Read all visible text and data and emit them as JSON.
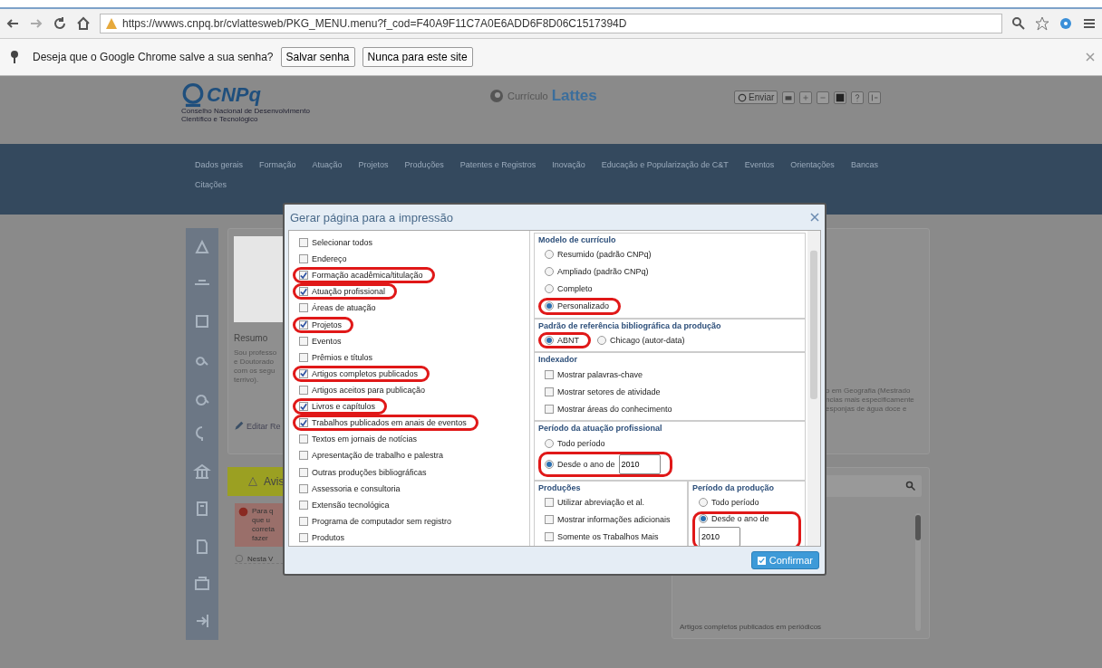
{
  "browser": {
    "url": "https://wwws.cnpq.br/cvlattesweb/PKG_MENU.menu?f_cod=F40A9F11C7A0E6ADD6F8D06C1517394D",
    "infobar": {
      "message": "Deseja que o Google Chrome salve a sua senha?",
      "buttons": [
        "Salvar senha",
        "Nunca para este site"
      ]
    }
  },
  "header": {
    "logo": "CNPq",
    "logo_subtitle_lines": [
      "Conselho Nacional de Desenvolvimento",
      "Científico e Tecnológico"
    ],
    "brand_prefix": "Currículo",
    "brand": "Lattes",
    "send_button": "Enviar"
  },
  "nav": {
    "items": [
      "Dados gerais",
      "Formação",
      "Atuação",
      "Projetos",
      "Produções",
      "Patentes e Registros",
      "Inovação",
      "Educação e Popularização de C&T",
      "Eventos",
      "Orientações",
      "Bancas",
      "Citações"
    ]
  },
  "profile": {
    "summary_title": "Resumo",
    "summary_lines": [
      "Sou professo",
      "e Doutorado",
      "com os segu",
      "terrivo)."
    ],
    "edit_link": "Editar Re",
    "right_lines": [
      "o em Geografia (Mestrado",
      "ncias mais especificamente",
      "esponjas de água doce e"
    ]
  },
  "notices": {
    "title": "Avis",
    "alert_lines": [
      "Para q",
      "que u",
      "correta",
      "fazer"
    ],
    "info": "Nesta V"
  },
  "list_panel": {
    "items": [
      "Artigos completos publicados em periódicos"
    ]
  },
  "dialog": {
    "title": "Gerar página para a impressão",
    "confirm": "Confirmar",
    "items": [
      {
        "label": "Selecionar todos",
        "checked": false,
        "circled": false
      },
      {
        "label": "Endereço",
        "checked": false,
        "circled": false
      },
      {
        "label": "Formação acadêmica/titulação",
        "checked": true,
        "circled": true
      },
      {
        "label": "Atuação profissional",
        "checked": true,
        "circled": true
      },
      {
        "label": "Áreas de atuação",
        "checked": false,
        "circled": false
      },
      {
        "label": "Projetos",
        "checked": true,
        "circled": true
      },
      {
        "label": "Eventos",
        "checked": false,
        "circled": false
      },
      {
        "label": "Prêmios e títulos",
        "checked": false,
        "circled": false
      },
      {
        "label": "Artigos completos publicados",
        "checked": true,
        "circled": true
      },
      {
        "label": "Artigos aceitos para publicação",
        "checked": false,
        "circled": false
      },
      {
        "label": "Livros e capítulos",
        "checked": true,
        "circled": true
      },
      {
        "label": "Trabalhos publicados em anais de eventos",
        "checked": true,
        "circled": true
      },
      {
        "label": "Textos em jornais de notícias",
        "checked": false,
        "circled": false
      },
      {
        "label": "Apresentação de trabalho e palestra",
        "checked": false,
        "circled": false
      },
      {
        "label": "Outras produções bibliográficas",
        "checked": false,
        "circled": false
      },
      {
        "label": "Assessoria e consultoria",
        "checked": false,
        "circled": false
      },
      {
        "label": "Extensão tecnológica",
        "checked": false,
        "circled": false
      },
      {
        "label": "Programa de computador sem registro",
        "checked": false,
        "circled": false
      },
      {
        "label": "Produtos",
        "checked": false,
        "circled": false
      }
    ],
    "fieldsets": [
      {
        "title": "Modelo de currículo",
        "kind": "radio",
        "options": [
          {
            "label": "Resumido (padrão CNPq)",
            "selected": false,
            "circled": false
          },
          {
            "label": "Ampliado (padrão CNPq)",
            "selected": false,
            "circled": false
          },
          {
            "label": "Completo",
            "selected": false,
            "circled": false
          },
          {
            "label": "Personalizado",
            "selected": true,
            "circled": true
          }
        ]
      },
      {
        "title": "Padrão de referência bibliográfica da produção",
        "kind": "radio",
        "inline": true,
        "options": [
          {
            "label": "ABNT",
            "selected": true,
            "circled": true
          },
          {
            "label": "Chicago (autor-data)",
            "selected": false,
            "circled": false
          }
        ]
      },
      {
        "title": "Indexador",
        "kind": "checkbox",
        "options": [
          {
            "label": "Mostrar palavras-chave",
            "checked": false,
            "circled": false
          },
          {
            "label": "Mostrar setores de atividade",
            "checked": false,
            "circled": false
          },
          {
            "label": "Mostrar áreas do conhecimento",
            "checked": false,
            "circled": false
          }
        ]
      },
      {
        "title": "Período da atuação profissional",
        "kind": "radio",
        "options": [
          {
            "label": "Todo período",
            "selected": false,
            "circled": false
          },
          {
            "label": "Desde o ano de",
            "selected": true,
            "circled": true,
            "year": "2010"
          }
        ]
      }
    ],
    "bottom_fieldsets": [
      {
        "title": "Produções",
        "kind": "checkbox",
        "options": [
          {
            "label": "Utilizar abreviação et al.",
            "checked": false,
            "circled": false
          },
          {
            "label": "Mostrar informações adicionais",
            "checked": false,
            "circled": false
          },
          {
            "label": "Somente os Trabalhos Mais",
            "checked": false,
            "circled": false
          }
        ]
      },
      {
        "title": "Período da produção",
        "kind": "radio",
        "options": [
          {
            "label": "Todo período",
            "selected": false,
            "circled": false
          },
          {
            "label": "Desde o ano de",
            "selected": true,
            "circled": true,
            "year": "2010"
          }
        ]
      }
    ]
  }
}
